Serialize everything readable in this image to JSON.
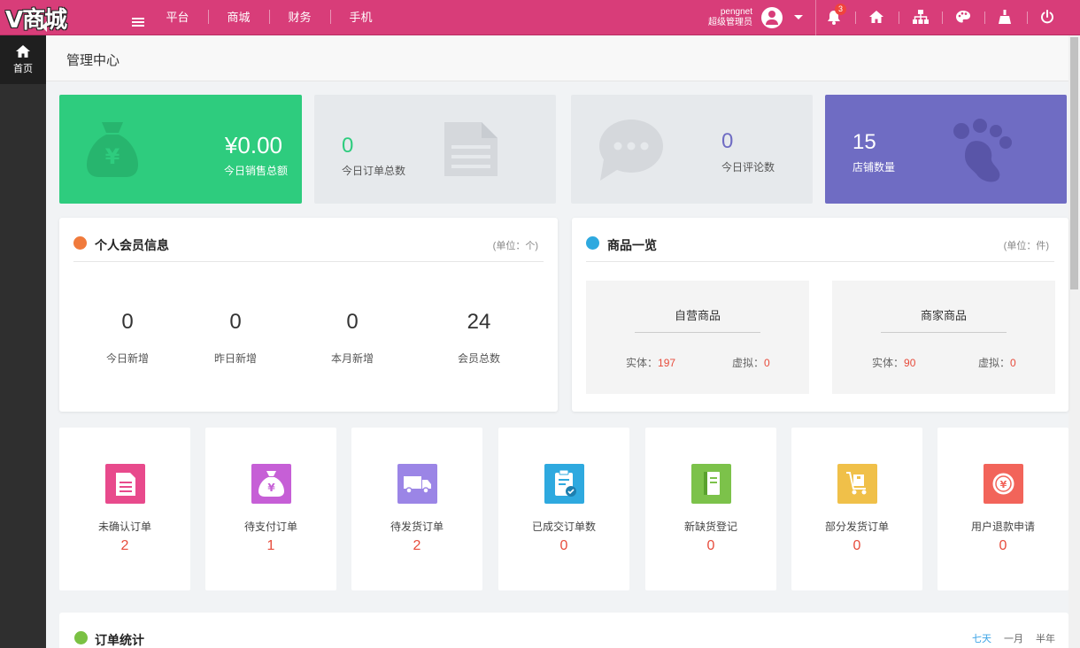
{
  "header": {
    "logo": "V商城",
    "nav": [
      {
        "label": "平台"
      },
      {
        "label": "商城"
      },
      {
        "label": "财务"
      },
      {
        "label": "手机"
      }
    ],
    "user": {
      "name": "pengnet",
      "role": "超级管理员"
    },
    "notification_count": "3",
    "icons": [
      "bell-icon",
      "home-icon",
      "sitemap-icon",
      "palette-icon",
      "clean-icon",
      "power-icon"
    ]
  },
  "sidebar": {
    "home_label": "首页"
  },
  "breadcrumb": {
    "title": "管理中心"
  },
  "stats": [
    {
      "value": "¥0.00",
      "label": "今日销售总额",
      "color": "#2ecc7e",
      "icon": "money-bag-icon"
    },
    {
      "value": "0",
      "label": "今日订单总数",
      "color": "#e6e9ec",
      "icon": "document-icon"
    },
    {
      "value": "0",
      "label": "今日评论数",
      "color": "#e6e9ec",
      "icon": "chat-bubble-icon"
    },
    {
      "value": "15",
      "label": "店铺数量",
      "color": "#6f6cc3",
      "icon": "paw-icon"
    }
  ],
  "members": {
    "title": "个人会员信息",
    "unit": "(单位：个)",
    "items": [
      {
        "value": "0",
        "label": "今日新增"
      },
      {
        "value": "0",
        "label": "昨日新增"
      },
      {
        "value": "0",
        "label": "本月新增"
      },
      {
        "value": "24",
        "label": "会员总数"
      }
    ]
  },
  "goods": {
    "title": "商品一览",
    "unit": "(单位：件)",
    "groups": [
      {
        "title": "自营商品",
        "physical_label": "实体：",
        "physical": "197",
        "virtual_label": "虚拟：",
        "virtual": "0"
      },
      {
        "title": "商家商品",
        "physical_label": "实体：",
        "physical": "90",
        "virtual_label": "虚拟：",
        "virtual": "0"
      }
    ]
  },
  "orders": [
    {
      "label": "未确认订单",
      "value": "2",
      "color": "#e84a8c",
      "icon": "unconfirmed-order-icon"
    },
    {
      "label": "待支付订单",
      "value": "1",
      "color": "#c65fd6",
      "icon": "money-bag-icon"
    },
    {
      "label": "待发货订单",
      "value": "2",
      "color": "#9b85e6",
      "icon": "truck-icon"
    },
    {
      "label": "已成交订单数",
      "value": "0",
      "color": "#2ea9df",
      "icon": "clipboard-check-icon"
    },
    {
      "label": "新缺货登记",
      "value": "0",
      "color": "#7cc24a",
      "icon": "notebook-icon"
    },
    {
      "label": "部分发货订单",
      "value": "0",
      "color": "#f0c049",
      "icon": "cart-box-icon"
    },
    {
      "label": "用户退款申请",
      "value": "0",
      "color": "#f2645a",
      "icon": "refund-icon"
    }
  ],
  "order_stats": {
    "title": "订单统计",
    "tabs": [
      {
        "label": "七天",
        "active": true
      },
      {
        "label": "一月",
        "active": false
      },
      {
        "label": "半年",
        "active": false
      }
    ]
  }
}
